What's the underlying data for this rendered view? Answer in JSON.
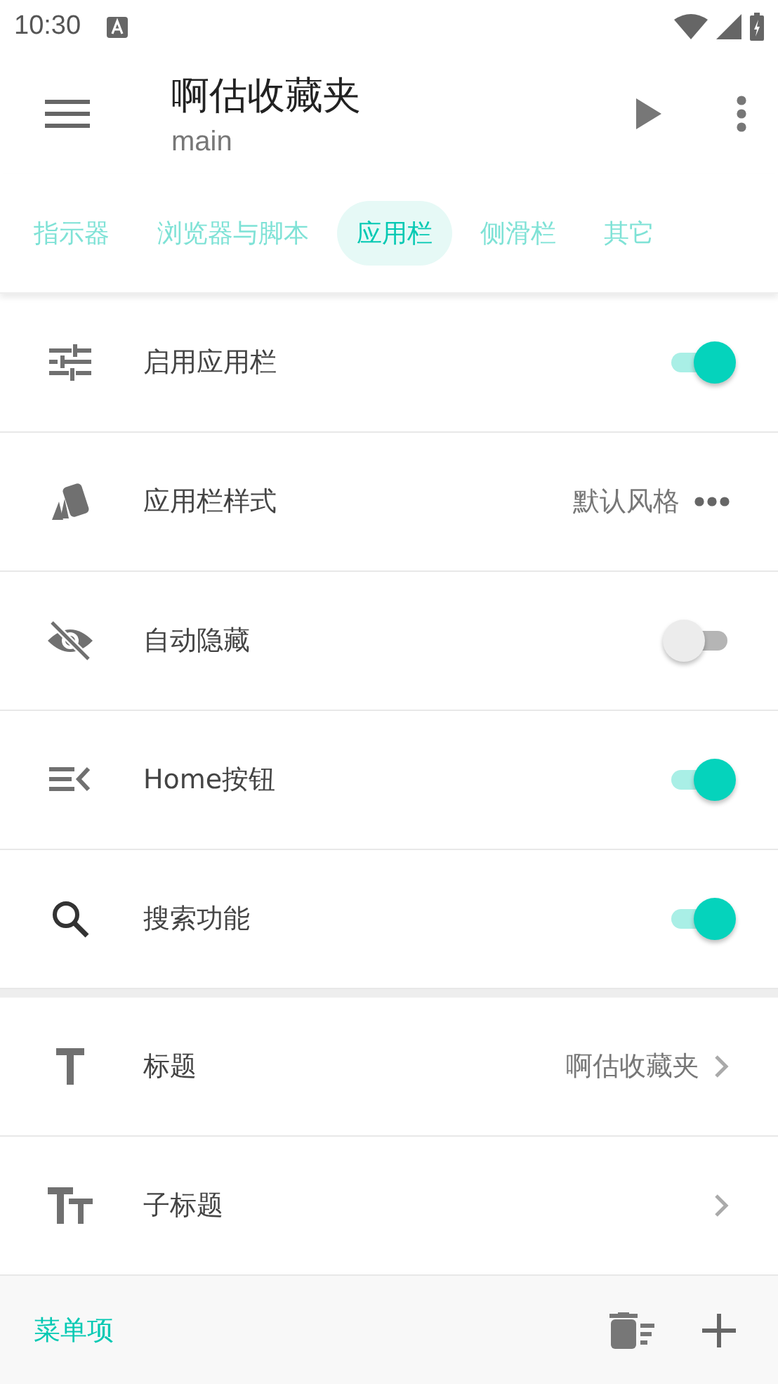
{
  "status_bar": {
    "time": "10:30"
  },
  "app_bar": {
    "title": "啊估收藏夹",
    "subtitle": "main"
  },
  "tabs": [
    {
      "label": "指示器",
      "selected": false
    },
    {
      "label": "浏览器与脚本",
      "selected": false
    },
    {
      "label": "应用栏",
      "selected": true
    },
    {
      "label": "侧滑栏",
      "selected": false
    },
    {
      "label": "其它",
      "selected": false
    }
  ],
  "sections": [
    {
      "rows": [
        {
          "kind": "switch",
          "label": "启用应用栏",
          "on": true
        },
        {
          "kind": "choice",
          "label": "应用栏样式",
          "value": "默认风格"
        },
        {
          "kind": "switch",
          "label": "自动隐藏",
          "on": false
        },
        {
          "kind": "switch",
          "label": "Home按钮",
          "on": true
        },
        {
          "kind": "switch",
          "label": "搜索功能",
          "on": true
        }
      ]
    },
    {
      "rows": [
        {
          "kind": "link",
          "label": "标题",
          "value": "啊估收藏夹"
        },
        {
          "kind": "link",
          "label": "子标题"
        }
      ]
    }
  ],
  "footer": {
    "label": "菜单项"
  }
}
